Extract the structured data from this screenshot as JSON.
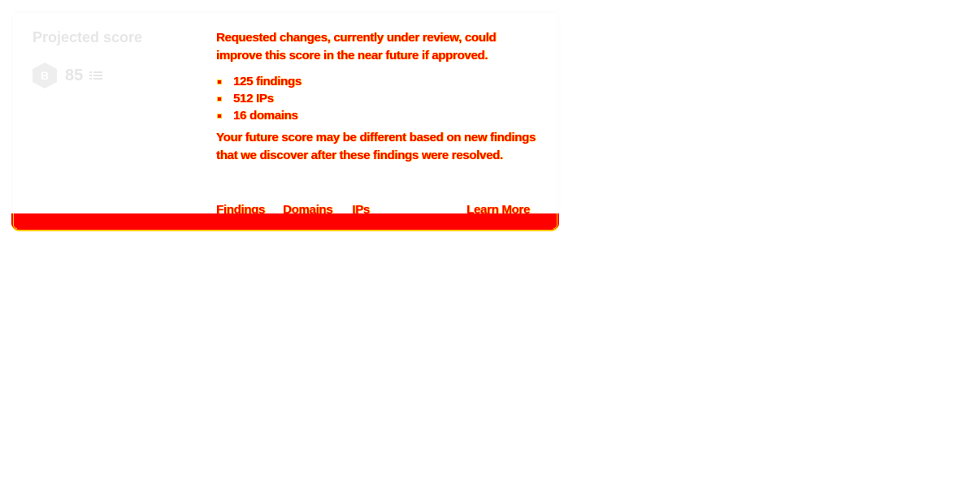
{
  "card": {
    "title": "Projected score",
    "grade": "B",
    "score": "85",
    "message": "Requested changes, currently under review, could improve this score in the near future if approved.",
    "stats": [
      "125 findings",
      "512 IPs",
      "16 domains"
    ],
    "disclaimer": "Your future score may be different based on new findings that we discover after these findings were resolved.",
    "links": {
      "findings": "Findings",
      "domains": "Domains",
      "ips": "IPs",
      "learn_more": "Learn More"
    }
  },
  "colors": {
    "text": "#ff0000",
    "outline": "#ffcc00",
    "muted": "#e6e6e6",
    "footer": "#ff0000"
  }
}
